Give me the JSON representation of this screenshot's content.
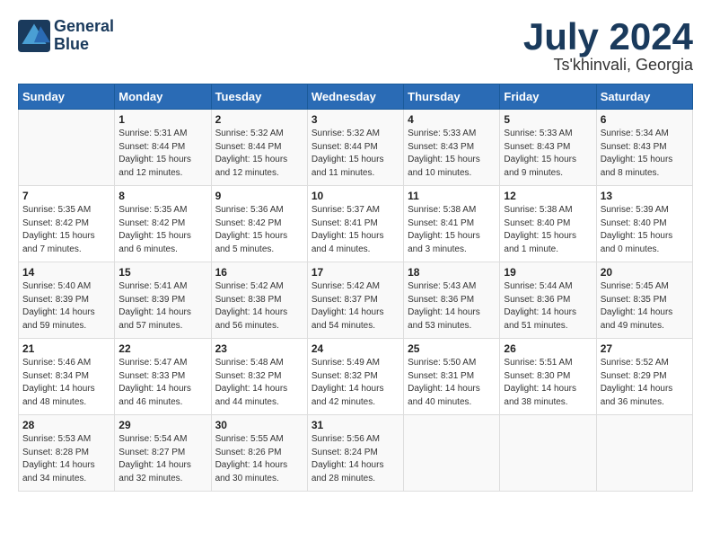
{
  "header": {
    "logo_line1": "General",
    "logo_line2": "Blue",
    "title": "July 2024",
    "subtitle": "Ts'khinvali, Georgia"
  },
  "days_of_week": [
    "Sunday",
    "Monday",
    "Tuesday",
    "Wednesday",
    "Thursday",
    "Friday",
    "Saturday"
  ],
  "weeks": [
    [
      {
        "day": "",
        "info": ""
      },
      {
        "day": "1",
        "info": "Sunrise: 5:31 AM\nSunset: 8:44 PM\nDaylight: 15 hours\nand 12 minutes."
      },
      {
        "day": "2",
        "info": "Sunrise: 5:32 AM\nSunset: 8:44 PM\nDaylight: 15 hours\nand 12 minutes."
      },
      {
        "day": "3",
        "info": "Sunrise: 5:32 AM\nSunset: 8:44 PM\nDaylight: 15 hours\nand 11 minutes."
      },
      {
        "day": "4",
        "info": "Sunrise: 5:33 AM\nSunset: 8:43 PM\nDaylight: 15 hours\nand 10 minutes."
      },
      {
        "day": "5",
        "info": "Sunrise: 5:33 AM\nSunset: 8:43 PM\nDaylight: 15 hours\nand 9 minutes."
      },
      {
        "day": "6",
        "info": "Sunrise: 5:34 AM\nSunset: 8:43 PM\nDaylight: 15 hours\nand 8 minutes."
      }
    ],
    [
      {
        "day": "7",
        "info": "Sunrise: 5:35 AM\nSunset: 8:42 PM\nDaylight: 15 hours\nand 7 minutes."
      },
      {
        "day": "8",
        "info": "Sunrise: 5:35 AM\nSunset: 8:42 PM\nDaylight: 15 hours\nand 6 minutes."
      },
      {
        "day": "9",
        "info": "Sunrise: 5:36 AM\nSunset: 8:42 PM\nDaylight: 15 hours\nand 5 minutes."
      },
      {
        "day": "10",
        "info": "Sunrise: 5:37 AM\nSunset: 8:41 PM\nDaylight: 15 hours\nand 4 minutes."
      },
      {
        "day": "11",
        "info": "Sunrise: 5:38 AM\nSunset: 8:41 PM\nDaylight: 15 hours\nand 3 minutes."
      },
      {
        "day": "12",
        "info": "Sunrise: 5:38 AM\nSunset: 8:40 PM\nDaylight: 15 hours\nand 1 minute."
      },
      {
        "day": "13",
        "info": "Sunrise: 5:39 AM\nSunset: 8:40 PM\nDaylight: 15 hours\nand 0 minutes."
      }
    ],
    [
      {
        "day": "14",
        "info": "Sunrise: 5:40 AM\nSunset: 8:39 PM\nDaylight: 14 hours\nand 59 minutes."
      },
      {
        "day": "15",
        "info": "Sunrise: 5:41 AM\nSunset: 8:39 PM\nDaylight: 14 hours\nand 57 minutes."
      },
      {
        "day": "16",
        "info": "Sunrise: 5:42 AM\nSunset: 8:38 PM\nDaylight: 14 hours\nand 56 minutes."
      },
      {
        "day": "17",
        "info": "Sunrise: 5:42 AM\nSunset: 8:37 PM\nDaylight: 14 hours\nand 54 minutes."
      },
      {
        "day": "18",
        "info": "Sunrise: 5:43 AM\nSunset: 8:36 PM\nDaylight: 14 hours\nand 53 minutes."
      },
      {
        "day": "19",
        "info": "Sunrise: 5:44 AM\nSunset: 8:36 PM\nDaylight: 14 hours\nand 51 minutes."
      },
      {
        "day": "20",
        "info": "Sunrise: 5:45 AM\nSunset: 8:35 PM\nDaylight: 14 hours\nand 49 minutes."
      }
    ],
    [
      {
        "day": "21",
        "info": "Sunrise: 5:46 AM\nSunset: 8:34 PM\nDaylight: 14 hours\nand 48 minutes."
      },
      {
        "day": "22",
        "info": "Sunrise: 5:47 AM\nSunset: 8:33 PM\nDaylight: 14 hours\nand 46 minutes."
      },
      {
        "day": "23",
        "info": "Sunrise: 5:48 AM\nSunset: 8:32 PM\nDaylight: 14 hours\nand 44 minutes."
      },
      {
        "day": "24",
        "info": "Sunrise: 5:49 AM\nSunset: 8:32 PM\nDaylight: 14 hours\nand 42 minutes."
      },
      {
        "day": "25",
        "info": "Sunrise: 5:50 AM\nSunset: 8:31 PM\nDaylight: 14 hours\nand 40 minutes."
      },
      {
        "day": "26",
        "info": "Sunrise: 5:51 AM\nSunset: 8:30 PM\nDaylight: 14 hours\nand 38 minutes."
      },
      {
        "day": "27",
        "info": "Sunrise: 5:52 AM\nSunset: 8:29 PM\nDaylight: 14 hours\nand 36 minutes."
      }
    ],
    [
      {
        "day": "28",
        "info": "Sunrise: 5:53 AM\nSunset: 8:28 PM\nDaylight: 14 hours\nand 34 minutes."
      },
      {
        "day": "29",
        "info": "Sunrise: 5:54 AM\nSunset: 8:27 PM\nDaylight: 14 hours\nand 32 minutes."
      },
      {
        "day": "30",
        "info": "Sunrise: 5:55 AM\nSunset: 8:26 PM\nDaylight: 14 hours\nand 30 minutes."
      },
      {
        "day": "31",
        "info": "Sunrise: 5:56 AM\nSunset: 8:24 PM\nDaylight: 14 hours\nand 28 minutes."
      },
      {
        "day": "",
        "info": ""
      },
      {
        "day": "",
        "info": ""
      },
      {
        "day": "",
        "info": ""
      }
    ]
  ]
}
